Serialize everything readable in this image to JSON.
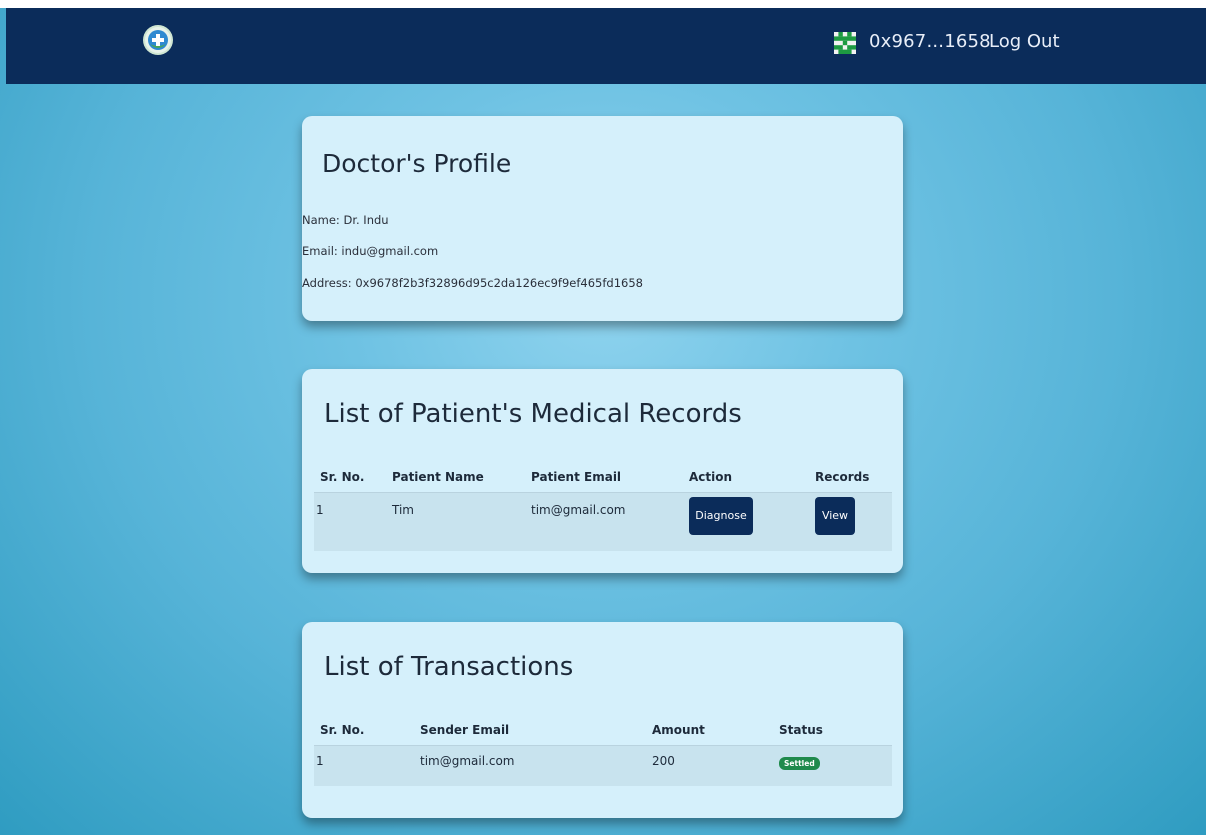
{
  "navbar": {
    "wallet_short": "0x967...1658",
    "logout_label": "Log Out"
  },
  "profile": {
    "title": "Doctor's Profile",
    "name_line": "Name: Dr. Indu",
    "email_line": "Email: indu@gmail.com",
    "address_line": "Address: 0x9678f2b3f32896d95c2da126ec9f9ef465fd1658"
  },
  "records": {
    "title": "List of Patient's Medical Records",
    "columns": [
      "Sr. No.",
      "Patient Name",
      "Patient Email",
      "Action",
      "Records"
    ],
    "rows": [
      {
        "sr": "1",
        "name": "Tim",
        "email": "tim@gmail.com",
        "action_label": "Diagnose",
        "records_label": "View"
      }
    ]
  },
  "transactions": {
    "title": "List of Transactions",
    "columns": [
      "Sr. No.",
      "Sender Email",
      "Amount",
      "Status"
    ],
    "rows": [
      {
        "sr": "1",
        "sender": "tim@gmail.com",
        "amount": "200",
        "status": "Settled"
      }
    ]
  },
  "colors": {
    "navbar": "#0b2c5a",
    "card": "#d5f0fb",
    "button": "#0b2c5a",
    "status_settled": "#1f8a4c"
  },
  "icons": [
    "app-logo-icon",
    "identicon-avatar-icon"
  ]
}
